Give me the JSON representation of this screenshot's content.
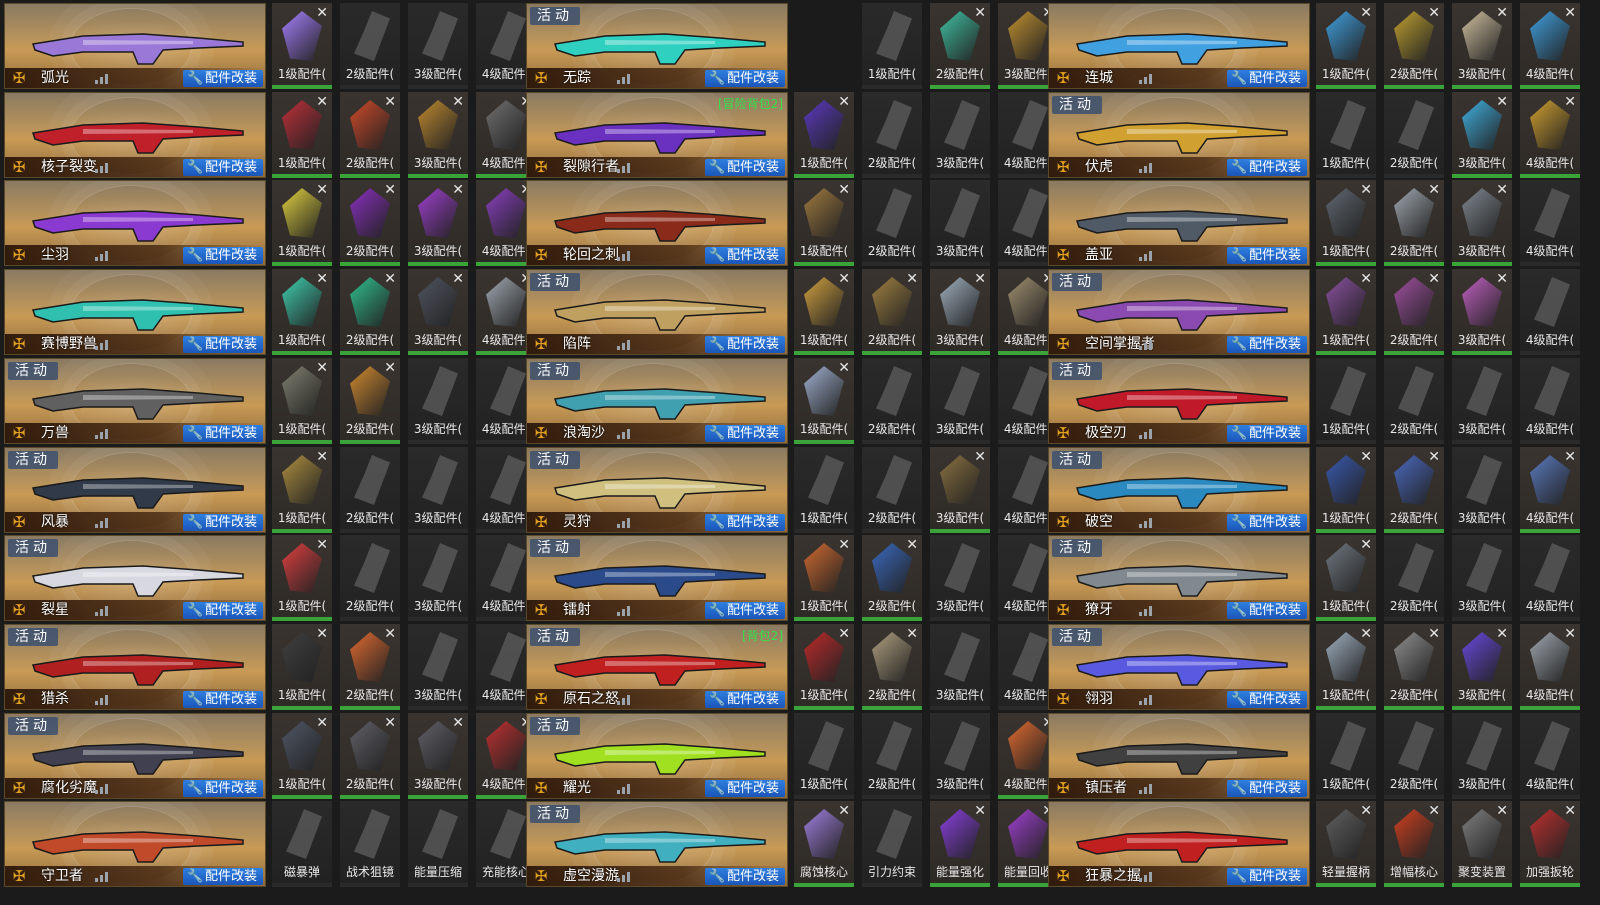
{
  "common": {
    "mod_label": "配件改装",
    "tag_label": "活动"
  },
  "accent_colors": {
    "modify_button": "#2a6fd6",
    "bag_label": "#35e04a",
    "equipped_bar": "#3aa33a"
  },
  "columns": [
    {
      "cards": [
        {
          "name": "弧光",
          "tag": false,
          "bag": "",
          "weapon_color": "#9a78d8",
          "slots": [
            {
              "label": "1级配件(",
              "filled": true,
              "color": "#a680ff"
            },
            {
              "label": "2级配件(",
              "filled": false
            },
            {
              "label": "3级配件(",
              "filled": false
            },
            {
              "label": "4级配件(",
              "filled": false
            }
          ]
        },
        {
          "name": "核子裂变",
          "tag": false,
          "bag": "",
          "weapon_color": "#c0202a",
          "slots": [
            {
              "label": "1级配件(",
              "filled": true,
              "color": "#c0303a"
            },
            {
              "label": "2级配件(",
              "filled": true,
              "color": "#d04a2a"
            },
            {
              "label": "3级配件(",
              "filled": true,
              "color": "#c08a30"
            },
            {
              "label": "4级配件(",
              "filled": true,
              "color": "#707070"
            }
          ]
        },
        {
          "name": "尘羽",
          "tag": false,
          "bag": "",
          "weapon_color": "#8a3ad0",
          "slots": [
            {
              "label": "1级配件(",
              "filled": true,
              "color": "#e0d040"
            },
            {
              "label": "2级配件(",
              "filled": true,
              "color": "#8a30c0"
            },
            {
              "label": "3级配件(",
              "filled": true,
              "color": "#a040d0"
            },
            {
              "label": "4级配件(",
              "filled": true,
              "color": "#8a40c0"
            }
          ]
        },
        {
          "name": "赛博野兽",
          "tag": false,
          "bag": "",
          "weapon_color": "#30c0b0",
          "slots": [
            {
              "label": "1级配件(",
              "filled": true,
              "color": "#40d0b0"
            },
            {
              "label": "2级配件(",
              "filled": true,
              "color": "#30c090"
            },
            {
              "label": "3级配件(",
              "filled": true,
              "color": "#505560"
            },
            {
              "label": "4级配件(",
              "filled": true,
              "color": "#a0a8b0"
            }
          ]
        },
        {
          "name": "万兽",
          "tag": true,
          "bag": "",
          "weapon_color": "#606060",
          "slots": [
            {
              "label": "1级配件(",
              "filled": true,
              "color": "#808070"
            },
            {
              "label": "2级配件(",
              "filled": true,
              "color": "#d08a30"
            },
            {
              "label": "3级配件(",
              "filled": false
            },
            {
              "label": "4级配件(",
              "filled": false
            }
          ]
        },
        {
          "name": "风暴",
          "tag": true,
          "bag": "",
          "weapon_color": "#303a48",
          "slots": [
            {
              "label": "1级配件(",
              "filled": true,
              "color": "#b09040"
            },
            {
              "label": "2级配件(",
              "filled": false
            },
            {
              "label": "3级配件(",
              "filled": false
            },
            {
              "label": "4级配件(",
              "filled": false
            }
          ]
        },
        {
          "name": "裂星",
          "tag": true,
          "bag": "",
          "weapon_color": "#d8d8e0",
          "slots": [
            {
              "label": "1级配件(",
              "filled": true,
              "color": "#e04040"
            },
            {
              "label": "2级配件(",
              "filled": false
            },
            {
              "label": "3级配件(",
              "filled": false
            },
            {
              "label": "4级配件(",
              "filled": false
            }
          ]
        },
        {
          "name": "猎杀",
          "tag": true,
          "bag": "",
          "weapon_color": "#b02020",
          "slots": [
            {
              "label": "1级配件(",
              "filled": true,
              "color": "#404040"
            },
            {
              "label": "2级配件(",
              "filled": true,
              "color": "#e06a30"
            },
            {
              "label": "3级配件(",
              "filled": false
            },
            {
              "label": "4级配件(",
              "filled": false
            }
          ]
        },
        {
          "name": "腐化劣魔",
          "tag": true,
          "bag": "",
          "weapon_color": "#404050",
          "slots": [
            {
              "label": "1级配件(",
              "filled": true,
              "color": "#505866"
            },
            {
              "label": "2级配件(",
              "filled": true,
              "color": "#606068"
            },
            {
              "label": "3级配件(",
              "filled": true,
              "color": "#606068"
            },
            {
              "label": "4级配件(",
              "filled": true,
              "color": "#c03030"
            }
          ]
        },
        {
          "name": "守卫者",
          "tag": false,
          "bag": "",
          "weapon_color": "#c04a2a",
          "slots": [
            {
              "label": "磁暴弹",
              "filled": false
            },
            {
              "label": "战术狙镜",
              "filled": false
            },
            {
              "label": "能量压缩",
              "filled": false
            },
            {
              "label": "充能核心",
              "filled": false
            }
          ]
        }
      ]
    },
    {
      "cards": [
        {
          "name": "无踪",
          "tag": true,
          "bag": "",
          "weapon_color": "#30d0c0",
          "slots": [
            {
              "label": "1级配件(",
              "filled": false
            },
            {
              "label": "2级配件(",
              "filled": true,
              "color": "#40c0a0"
            },
            {
              "label": "3级配件(",
              "filled": true,
              "color": "#c09030"
            }
          ]
        },
        {
          "name": "裂隙行者",
          "tag": false,
          "bag": "[冒险背包2]",
          "weapon_color": "#6a30c0",
          "slots": [
            {
              "label": "1级配件(",
              "filled": true,
              "color": "#5a3ac0"
            },
            {
              "label": "2级配件(",
              "filled": false
            },
            {
              "label": "3级配件(",
              "filled": false
            },
            {
              "label": "4级配件(",
              "filled": false
            }
          ]
        },
        {
          "name": "轮回之刺",
          "tag": false,
          "bag": "",
          "weapon_color": "#8a2a1a",
          "slots": [
            {
              "label": "1级配件(",
              "filled": true,
              "color": "#a07a40"
            },
            {
              "label": "2级配件(",
              "filled": false
            },
            {
              "label": "3级配件(",
              "filled": false
            },
            {
              "label": "4级配件(",
              "filled": false
            }
          ]
        },
        {
          "name": "陷阵",
          "tag": true,
          "bag": "",
          "weapon_color": "#c0a060",
          "slots": [
            {
              "label": "1级配件(",
              "filled": true,
              "color": "#d0a040"
            },
            {
              "label": "2级配件(",
              "filled": true,
              "color": "#a08040"
            },
            {
              "label": "3级配件(",
              "filled": true,
              "color": "#a0b0c0"
            },
            {
              "label": "4级配件(",
              "filled": true,
              "color": "#a09070"
            }
          ]
        },
        {
          "name": "浪淘沙",
          "tag": true,
          "bag": "",
          "weapon_color": "#40a0b0",
          "slots": [
            {
              "label": "1级配件(",
              "filled": true,
              "color": "#a0b0d0"
            },
            {
              "label": "2级配件(",
              "filled": false
            },
            {
              "label": "3级配件(",
              "filled": false
            },
            {
              "label": "4级配件(",
              "filled": false
            }
          ]
        },
        {
          "name": "灵狩",
          "tag": true,
          "bag": "",
          "weapon_color": "#d0c080",
          "slots": [
            {
              "label": "1级配件(",
              "filled": false
            },
            {
              "label": "2级配件(",
              "filled": false
            },
            {
              "label": "3级配件(",
              "filled": true,
              "color": "#8a7040"
            },
            {
              "label": "4级配件(",
              "filled": false
            }
          ]
        },
        {
          "name": "镭射",
          "tag": true,
          "bag": "",
          "weapon_color": "#2a4a8a",
          "slots": [
            {
              "label": "1级配件(",
              "filled": true,
              "color": "#d06a30"
            },
            {
              "label": "2级配件(",
              "filled": true,
              "color": "#3a6ac0"
            },
            {
              "label": "3级配件(",
              "filled": false
            },
            {
              "label": "4级配件(",
              "filled": false
            }
          ]
        },
        {
          "name": "原石之怒",
          "tag": true,
          "bag": "[背包2]",
          "weapon_color": "#c02020",
          "slots": [
            {
              "label": "1级配件(",
              "filled": true,
              "color": "#c02a2a"
            },
            {
              "label": "2级配件(",
              "filled": true,
              "color": "#b0a080"
            },
            {
              "label": "3级配件(",
              "filled": false
            },
            {
              "label": "4级配件(",
              "filled": false
            }
          ]
        },
        {
          "name": "耀光",
          "tag": true,
          "bag": "",
          "weapon_color": "#a0e020",
          "slots": [
            {
              "label": "1级配件(",
              "filled": false
            },
            {
              "label": "2级配件(",
              "filled": false
            },
            {
              "label": "3级配件(",
              "filled": false
            },
            {
              "label": "4级配件(",
              "filled": true,
              "color": "#e06a30"
            }
          ]
        },
        {
          "name": "虚空漫游",
          "tag": true,
          "bag": "",
          "weapon_color": "#40b0c0",
          "slots": [
            {
              "label": "腐蚀核心",
              "filled": true,
              "color": "#a080e0"
            },
            {
              "label": "引力约束",
              "filled": false
            },
            {
              "label": "能量强化",
              "filled": true,
              "color": "#8a40e0"
            },
            {
              "label": "能量回收",
              "filled": true,
              "color": "#a040d0"
            }
          ]
        }
      ]
    },
    {
      "cards": [
        {
          "name": "连城",
          "tag": false,
          "bag": "",
          "weapon_color": "#40a0e0",
          "slots": [
            {
              "label": "1级配件(",
              "filled": true,
              "color": "#40a0e0"
            },
            {
              "label": "2级配件(",
              "filled": true,
              "color": "#c0a030"
            },
            {
              "label": "3级配件(",
              "filled": true,
              "color": "#d0c0a0"
            },
            {
              "label": "4级配件(",
              "filled": true,
              "color": "#40a0e0"
            }
          ]
        },
        {
          "name": "伏虎",
          "tag": true,
          "bag": "",
          "weapon_color": "#d0a030",
          "slots": [
            {
              "label": "1级配件(",
              "filled": false
            },
            {
              "label": "2级配件(",
              "filled": false
            },
            {
              "label": "3级配件(",
              "filled": true,
              "color": "#40b0e0"
            },
            {
              "label": "4级配件(",
              "filled": true,
              "color": "#d0a030"
            }
          ]
        },
        {
          "name": "盖亚",
          "tag": false,
          "bag": "",
          "weapon_color": "#505a66",
          "slots": [
            {
              "label": "1级配件(",
              "filled": true,
              "color": "#606870"
            },
            {
              "label": "2级配件(",
              "filled": true,
              "color": "#a0a8b0"
            },
            {
              "label": "3级配件(",
              "filled": true,
              "color": "#808890"
            },
            {
              "label": "4级配件(",
              "filled": false
            }
          ]
        },
        {
          "name": "空间掌握者",
          "tag": true,
          "bag": "",
          "weapon_color": "#8a4ab0",
          "slots": [
            {
              "label": "1级配件(",
              "filled": true,
              "color": "#8a50a0"
            },
            {
              "label": "2级配件(",
              "filled": true,
              "color": "#a050a0"
            },
            {
              "label": "3级配件(",
              "filled": true,
              "color": "#c060c0"
            },
            {
              "label": "4级配件(",
              "filled": false
            }
          ]
        },
        {
          "name": "极空刃",
          "tag": true,
          "bag": "",
          "weapon_color": "#c01a2a",
          "slots": [
            {
              "label": "1级配件(",
              "filled": false
            },
            {
              "label": "2级配件(",
              "filled": false
            },
            {
              "label": "3级配件(",
              "filled": false
            },
            {
              "label": "4级配件(",
              "filled": false
            }
          ]
        },
        {
          "name": "破空",
          "tag": true,
          "bag": "",
          "weapon_color": "#2a8ac0",
          "slots": [
            {
              "label": "1级配件(",
              "filled": true,
              "color": "#3a5ab0"
            },
            {
              "label": "2级配件(",
              "filled": true,
              "color": "#4a6ac0"
            },
            {
              "label": "3级配件(",
              "filled": false
            },
            {
              "label": "4级配件(",
              "filled": true,
              "color": "#5a7ac0"
            }
          ]
        },
        {
          "name": "獠牙",
          "tag": true,
          "bag": "",
          "weapon_color": "#808890",
          "slots": [
            {
              "label": "1级配件(",
              "filled": true,
              "color": "#707880"
            },
            {
              "label": "2级配件(",
              "filled": false
            },
            {
              "label": "3级配件(",
              "filled": false
            },
            {
              "label": "4级配件(",
              "filled": false
            }
          ]
        },
        {
          "name": "翎羽",
          "tag": true,
          "bag": "",
          "weapon_color": "#5a5ae0",
          "slots": [
            {
              "label": "1级配件(",
              "filled": true,
              "color": "#a0b0c0"
            },
            {
              "label": "2级配件(",
              "filled": true,
              "color": "#909090"
            },
            {
              "label": "3级配件(",
              "filled": true,
              "color": "#6a4ae0"
            },
            {
              "label": "4级配件(",
              "filled": true,
              "color": "#a0a8b0"
            }
          ]
        },
        {
          "name": "镇压者",
          "tag": false,
          "bag": "",
          "weapon_color": "#404040",
          "slots": [
            {
              "label": "1级配件(",
              "filled": false
            },
            {
              "label": "2级配件(",
              "filled": false
            },
            {
              "label": "3级配件(",
              "filled": false
            },
            {
              "label": "4级配件(",
              "filled": false
            }
          ]
        },
        {
          "name": "狂暴之握",
          "tag": false,
          "bag": "",
          "weapon_color": "#c02020",
          "slots": [
            {
              "label": "轻量握柄",
              "filled": true,
              "color": "#606060"
            },
            {
              "label": "增幅核心",
              "filled": true,
              "color": "#d04020"
            },
            {
              "label": "聚变装置",
              "filled": true,
              "color": "#808080"
            },
            {
              "label": "加强扳轮",
              "filled": true,
              "color": "#c03030"
            }
          ]
        }
      ]
    }
  ]
}
